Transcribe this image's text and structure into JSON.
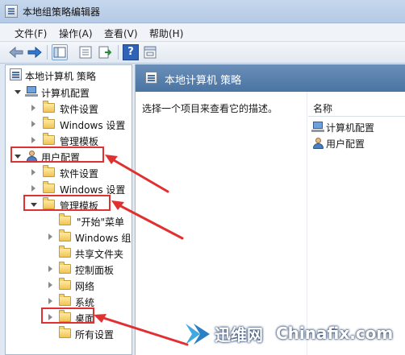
{
  "window": {
    "title": "本地组策略编辑器"
  },
  "menu": [
    {
      "label": "文件(F)"
    },
    {
      "label": "操作(A)"
    },
    {
      "label": "查看(V)"
    },
    {
      "label": "帮助(H)"
    }
  ],
  "toolbar": {
    "icons": [
      "back-arrow-icon",
      "forward-arrow-icon",
      "show-tree-icon",
      "properties-icon",
      "export-list-icon",
      "help-icon",
      "filter-view-icon"
    ],
    "help_glyph": "?"
  },
  "tree": {
    "root": "本地计算机 策略",
    "computer_config": "计算机配置",
    "computer_children": [
      "软件设置",
      "Windows 设置",
      "管理模板"
    ],
    "user_config": "用户配置",
    "user_children": [
      "软件设置",
      "Windows 设置",
      "管理模板"
    ],
    "admin_templates_children": [
      "\"开始\"菜单",
      "Windows 组",
      "共享文件夹",
      "控制面板",
      "网络",
      "系统",
      "桌面",
      "所有设置"
    ]
  },
  "details": {
    "title": "本地计算机 策略",
    "description": "选择一个项目来查看它的描述。",
    "column_name": "名称",
    "items": [
      "计算机配置",
      "用户配置"
    ]
  },
  "annotations": {
    "color": "#e03030"
  },
  "watermark": {
    "cn": "迅维网",
    "en": "Chinafix.com"
  },
  "colors": {
    "header": "#4b74a3",
    "folder": "#f0c450",
    "window": "#dfe8f3"
  }
}
